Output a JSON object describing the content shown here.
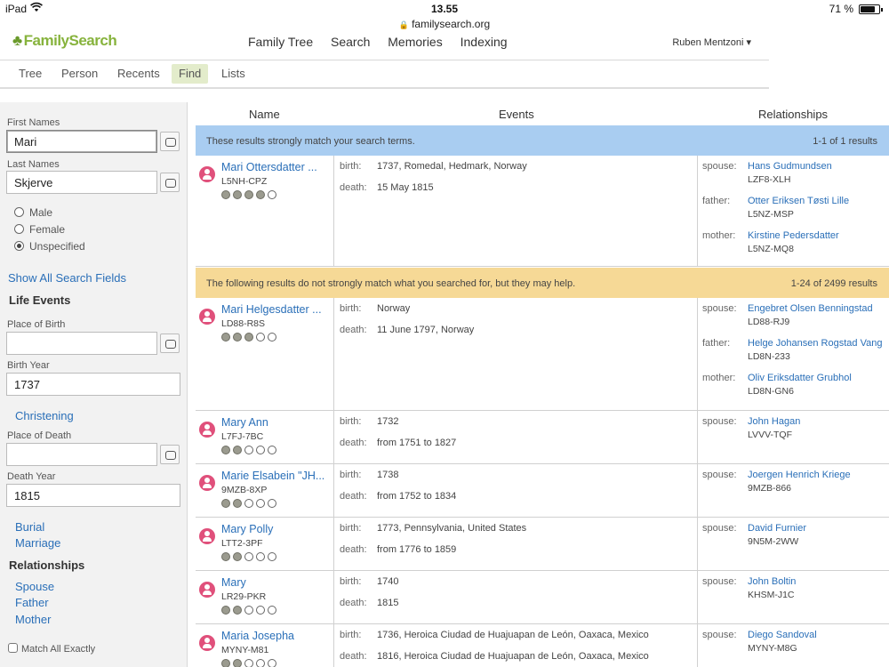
{
  "status": {
    "device": "iPad",
    "time": "13.55",
    "battery_pct": "71 %",
    "battery_level": 0.71,
    "url": "familysearch.org"
  },
  "header": {
    "logo": "FamilySearch",
    "nav": [
      "Family Tree",
      "Search",
      "Memories",
      "Indexing"
    ],
    "user": "Ruben Mentzoni ▾"
  },
  "subnav": {
    "tabs": [
      "Tree",
      "Person",
      "Recents",
      "Find",
      "Lists"
    ],
    "active": "Find"
  },
  "sidebar": {
    "first_names_label": "First Names",
    "first_names_value": "Mari",
    "last_names_label": "Last Names",
    "last_names_value": "Skjerve",
    "gender": [
      "Male",
      "Female",
      "Unspecified"
    ],
    "gender_selected": "Unspecified",
    "show_all": "Show All Search Fields",
    "life_events": "Life Events",
    "place_of_birth_label": "Place of Birth",
    "place_of_birth_value": "",
    "birth_year_label": "Birth Year",
    "birth_year_value": "1737",
    "christening": "Christening",
    "place_of_death_label": "Place of Death",
    "place_of_death_value": "",
    "death_year_label": "Death Year",
    "death_year_value": "1815",
    "burial": "Burial",
    "marriage": "Marriage",
    "relationships": "Relationships",
    "spouse": "Spouse",
    "father": "Father",
    "mother": "Mother",
    "match_exactly": "Match All Exactly"
  },
  "results": {
    "col_name": "Name",
    "col_events": "Events",
    "col_relationships": "Relationships",
    "strong_msg": "These results strongly match your search terms.",
    "strong_count": "1-1 of 1 results",
    "weak_msg": "The following results do not strongly match what you searched for, but they may help.",
    "weak_count": "1-24 of 2499 results",
    "strong": [
      {
        "name": "Mari Ottersdatter ...",
        "id": "L5NH-CPZ",
        "stars": 4,
        "birth_label": "birth:",
        "birth": "1737, Romedal, Hedmark, Norway",
        "death_label": "death:",
        "death": "15 May 1815",
        "rels": [
          {
            "label": "spouse:",
            "name": "Hans Gudmundsen",
            "id": "LZF8-XLH"
          },
          {
            "label": "father:",
            "name": "Otter Eriksen Tøsti Lille",
            "id": "L5NZ-MSP"
          },
          {
            "label": "mother:",
            "name": "Kirstine Pedersdatter",
            "id": "L5NZ-MQ8"
          }
        ]
      }
    ],
    "weak": [
      {
        "name": "Mari Helgesdatter ...",
        "id": "LD88-R8S",
        "stars": 3,
        "birth_label": "birth:",
        "birth": "Norway",
        "death_label": "death:",
        "death": "11 June 1797, Norway",
        "rels": [
          {
            "label": "spouse:",
            "name": "Engebret Olsen Benningstad",
            "id": "LD88-RJ9"
          },
          {
            "label": "father:",
            "name": "Helge Johansen Rogstad Vang",
            "id": "LD8N-233"
          },
          {
            "label": "mother:",
            "name": "Oliv Eriksdatter Grubhol",
            "id": "LD8N-GN6"
          }
        ]
      },
      {
        "name": "Mary Ann",
        "id": "L7FJ-7BC",
        "stars": 2,
        "birth_label": "birth:",
        "birth": "1732",
        "death_label": "death:",
        "death": "from 1751 to 1827",
        "rels": [
          {
            "label": "spouse:",
            "name": "John Hagan",
            "id": "LVVV-TQF"
          }
        ]
      },
      {
        "name": "Marie Elsabein \"JH...",
        "id": "9MZB-8XP",
        "stars": 2,
        "birth_label": "birth:",
        "birth": "1738",
        "death_label": "death:",
        "death": "from 1752 to 1834",
        "rels": [
          {
            "label": "spouse:",
            "name": "Joergen Henrich Kriege",
            "id": "9MZB-866"
          }
        ]
      },
      {
        "name": "Mary Polly",
        "id": "LTT2-3PF",
        "stars": 2,
        "birth_label": "birth:",
        "birth": "1773, Pennsylvania, United States",
        "death_label": "death:",
        "death": "from 1776 to 1859",
        "rels": [
          {
            "label": "spouse:",
            "name": "David Furnier",
            "id": "9N5M-2WW"
          }
        ]
      },
      {
        "name": "Mary",
        "id": "LR29-PKR",
        "stars": 2,
        "birth_label": "birth:",
        "birth": "1740",
        "death_label": "death:",
        "death": "1815",
        "rels": [
          {
            "label": "spouse:",
            "name": "John Boltin",
            "id": "KHSM-J1C"
          }
        ]
      },
      {
        "name": "Maria Josepha",
        "id": "MYNY-M81",
        "stars": 2,
        "birth_label": "birth:",
        "birth": "1736, Heroica Ciudad de Huajuapan de León, Oaxaca, Mexico",
        "death_label": "death:",
        "death": "1816, Heroica Ciudad de Huajuapan de León, Oaxaca, Mexico",
        "rels": [
          {
            "label": "spouse:",
            "name": "Diego Sandoval",
            "id": "MYNY-M8G"
          }
        ]
      }
    ]
  }
}
